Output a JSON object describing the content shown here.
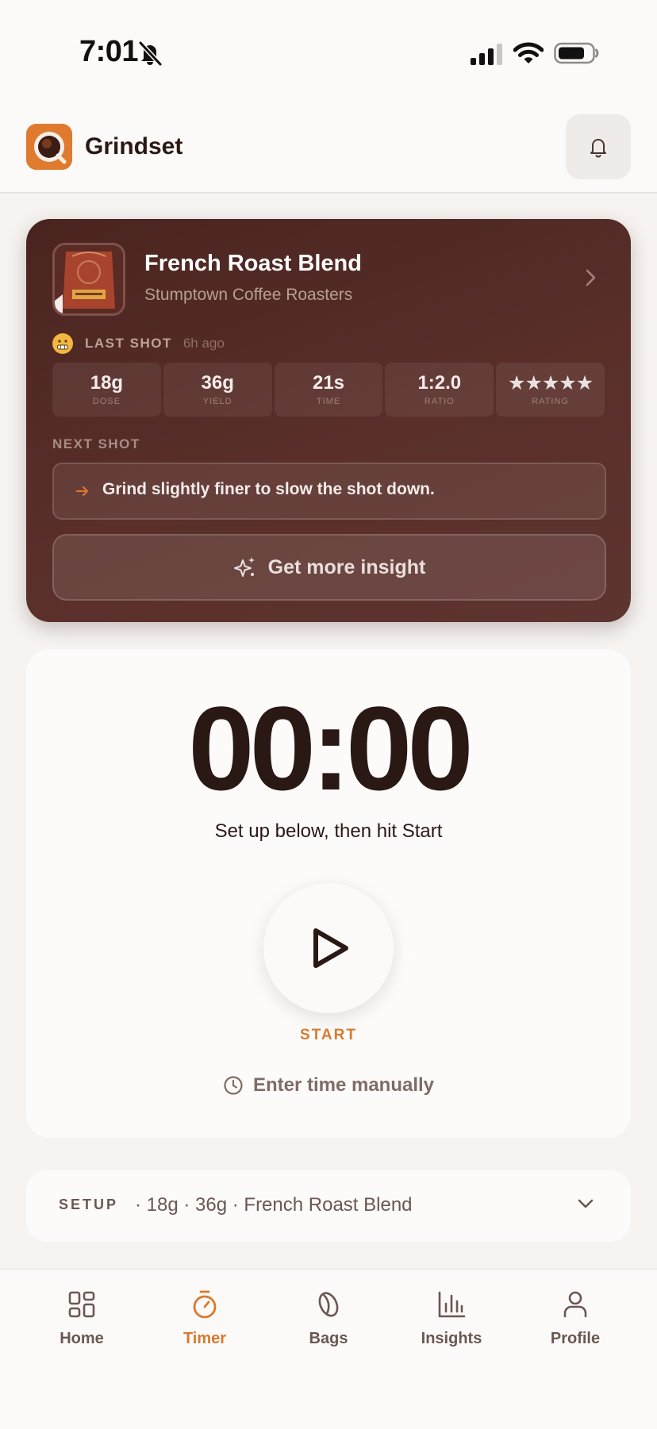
{
  "status_bar": {
    "time": "7:01"
  },
  "header": {
    "app_name": "Grindset"
  },
  "coffee_card": {
    "bean_name": "French Roast Blend",
    "roaster": "Stumptown Coffee Roasters",
    "last_shot": {
      "label": "LAST SHOT",
      "ago": "6h ago",
      "stats": [
        {
          "value": "18g",
          "label": "DOSE"
        },
        {
          "value": "36g",
          "label": "YIELD"
        },
        {
          "value": "21s",
          "label": "TIME"
        },
        {
          "value": "1:2.0",
          "label": "RATIO"
        }
      ],
      "rating": {
        "stars": "★★★★★",
        "value": 5,
        "max": 5,
        "label": "RATING"
      }
    },
    "next_shot": {
      "label": "NEXT SHOT",
      "tip": "Grind slightly finer to slow the shot down."
    },
    "insight_button": "Get more insight"
  },
  "timer": {
    "display": "00:00",
    "hint": "Set up below, then hit Start",
    "start_label": "START",
    "manual_label": "Enter time manually"
  },
  "setup": {
    "label": "SETUP",
    "summary": "· 18g · 36g · French Roast Blend"
  },
  "tabs": [
    {
      "label": "Home",
      "icon": "grid-icon"
    },
    {
      "label": "Timer",
      "icon": "stopwatch-icon",
      "active": true
    },
    {
      "label": "Bags",
      "icon": "coffee-bean-icon"
    },
    {
      "label": "Insights",
      "icon": "bar-chart-icon"
    },
    {
      "label": "Profile",
      "icon": "user-icon"
    }
  ],
  "colors": {
    "accent": "#d9792e",
    "card_dark": "#4e2723",
    "text_dark": "#2a1814",
    "background": "#f6f3f1"
  }
}
